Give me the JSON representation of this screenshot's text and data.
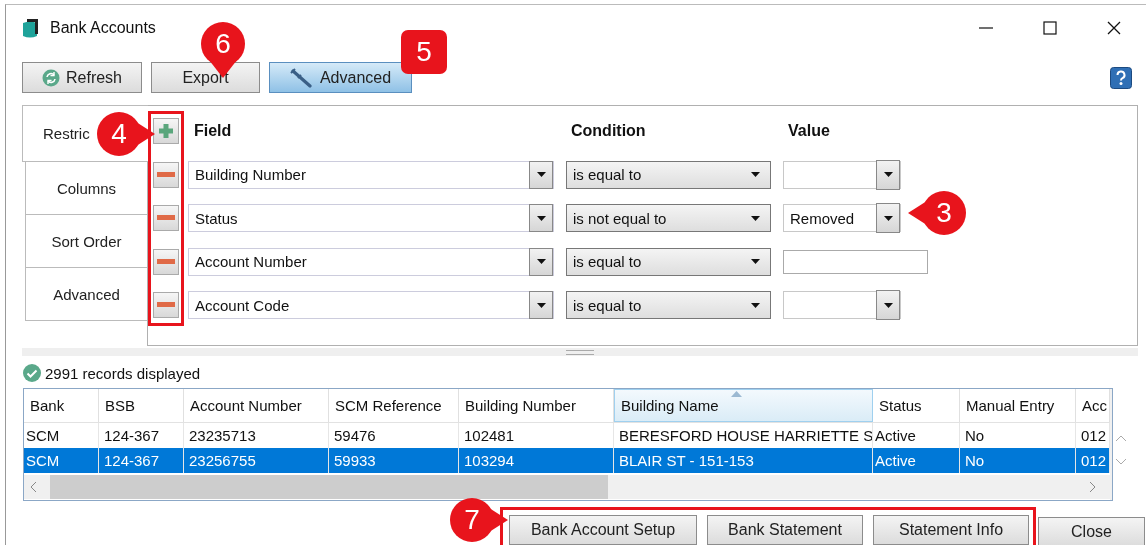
{
  "window": {
    "title": "Bank Accounts"
  },
  "toolbar": [
    {
      "label": "Refresh",
      "kind": "refresh",
      "selected": false
    },
    {
      "label": "Export",
      "kind": "plain",
      "selected": false
    },
    {
      "label": "Advanced",
      "kind": "tools",
      "selected": true
    }
  ],
  "side_tabs": [
    {
      "label": "Restric",
      "selected": true
    },
    {
      "label": "Columns",
      "selected": false
    },
    {
      "label": "Sort Order",
      "selected": false
    },
    {
      "label": "Advanced",
      "selected": false
    }
  ],
  "restrictions": {
    "highlighted": true,
    "headers": [
      "Field",
      "Condition",
      "Value"
    ],
    "rows": [
      {
        "field": "Building Number",
        "condition": "is equal to",
        "kind": "combo"
      },
      {
        "field": "Status",
        "condition": "is not equal to",
        "kind": "combo",
        "value": "Removed"
      },
      {
        "field": "Account Number",
        "condition": "is equal to",
        "kind": "text"
      },
      {
        "field": "Account Code",
        "condition": "is equal to",
        "kind": "combo"
      }
    ]
  },
  "status": {
    "text": "2991 records displayed"
  },
  "grid": {
    "columns": [
      {
        "label": "Bank",
        "sorted": false
      },
      {
        "label": "BSB",
        "sorted": false
      },
      {
        "label": "Account Number",
        "sorted": false
      },
      {
        "label": "SCM Reference",
        "sorted": false
      },
      {
        "label": "Building Number",
        "sorted": false
      },
      {
        "label": "Building Name",
        "sorted": true
      },
      {
        "label": "Status",
        "sorted": false
      },
      {
        "label": "Manual Entry",
        "sorted": false
      },
      {
        "label": "Acc",
        "sorted": false
      }
    ],
    "rows": [
      {
        "selected": false,
        "cells": [
          "SCM",
          "124-367",
          "23235713",
          "59476",
          "102481",
          "BERESFORD HOUSE HARRIETTE S",
          "Active",
          "No",
          "012"
        ]
      },
      {
        "selected": true,
        "cells": [
          "SCM",
          "124-367",
          "23256755",
          "59933",
          "103294",
          "BLAIR ST - 151-153",
          "Active",
          "No",
          "012"
        ]
      }
    ]
  },
  "footer": {
    "highlighted": [
      "Bank Account Setup",
      "Bank Statement",
      "Statement Info"
    ],
    "plain": [
      "Close"
    ]
  },
  "callouts": [
    {
      "number": "6",
      "kind": "down"
    },
    {
      "number": "5",
      "kind": "square"
    },
    {
      "number": "4",
      "kind": "right"
    },
    {
      "number": "3",
      "kind": "left"
    },
    {
      "number": "7",
      "kind": "right"
    }
  ]
}
